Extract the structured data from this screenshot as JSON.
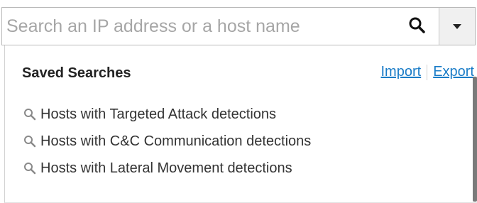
{
  "search": {
    "placeholder": "Search an IP address or a host name",
    "value": "",
    "search_icon": "search-icon",
    "dropdown_icon": "caret-down-icon"
  },
  "saved_searches": {
    "title": "Saved Searches",
    "import_label": "Import",
    "export_label": "Export",
    "items": [
      {
        "label": "Hosts with Targeted Attack detections",
        "icon": "search-icon"
      },
      {
        "label": "Hosts with C&C Communication detections",
        "icon": "search-icon"
      },
      {
        "label": "Hosts with Lateral Movement detections",
        "icon": "search-icon"
      }
    ]
  },
  "colors": {
    "link": "#1a7cc7",
    "border": "#b9b9b9",
    "text": "#333333",
    "placeholder": "#a6a6a6"
  }
}
